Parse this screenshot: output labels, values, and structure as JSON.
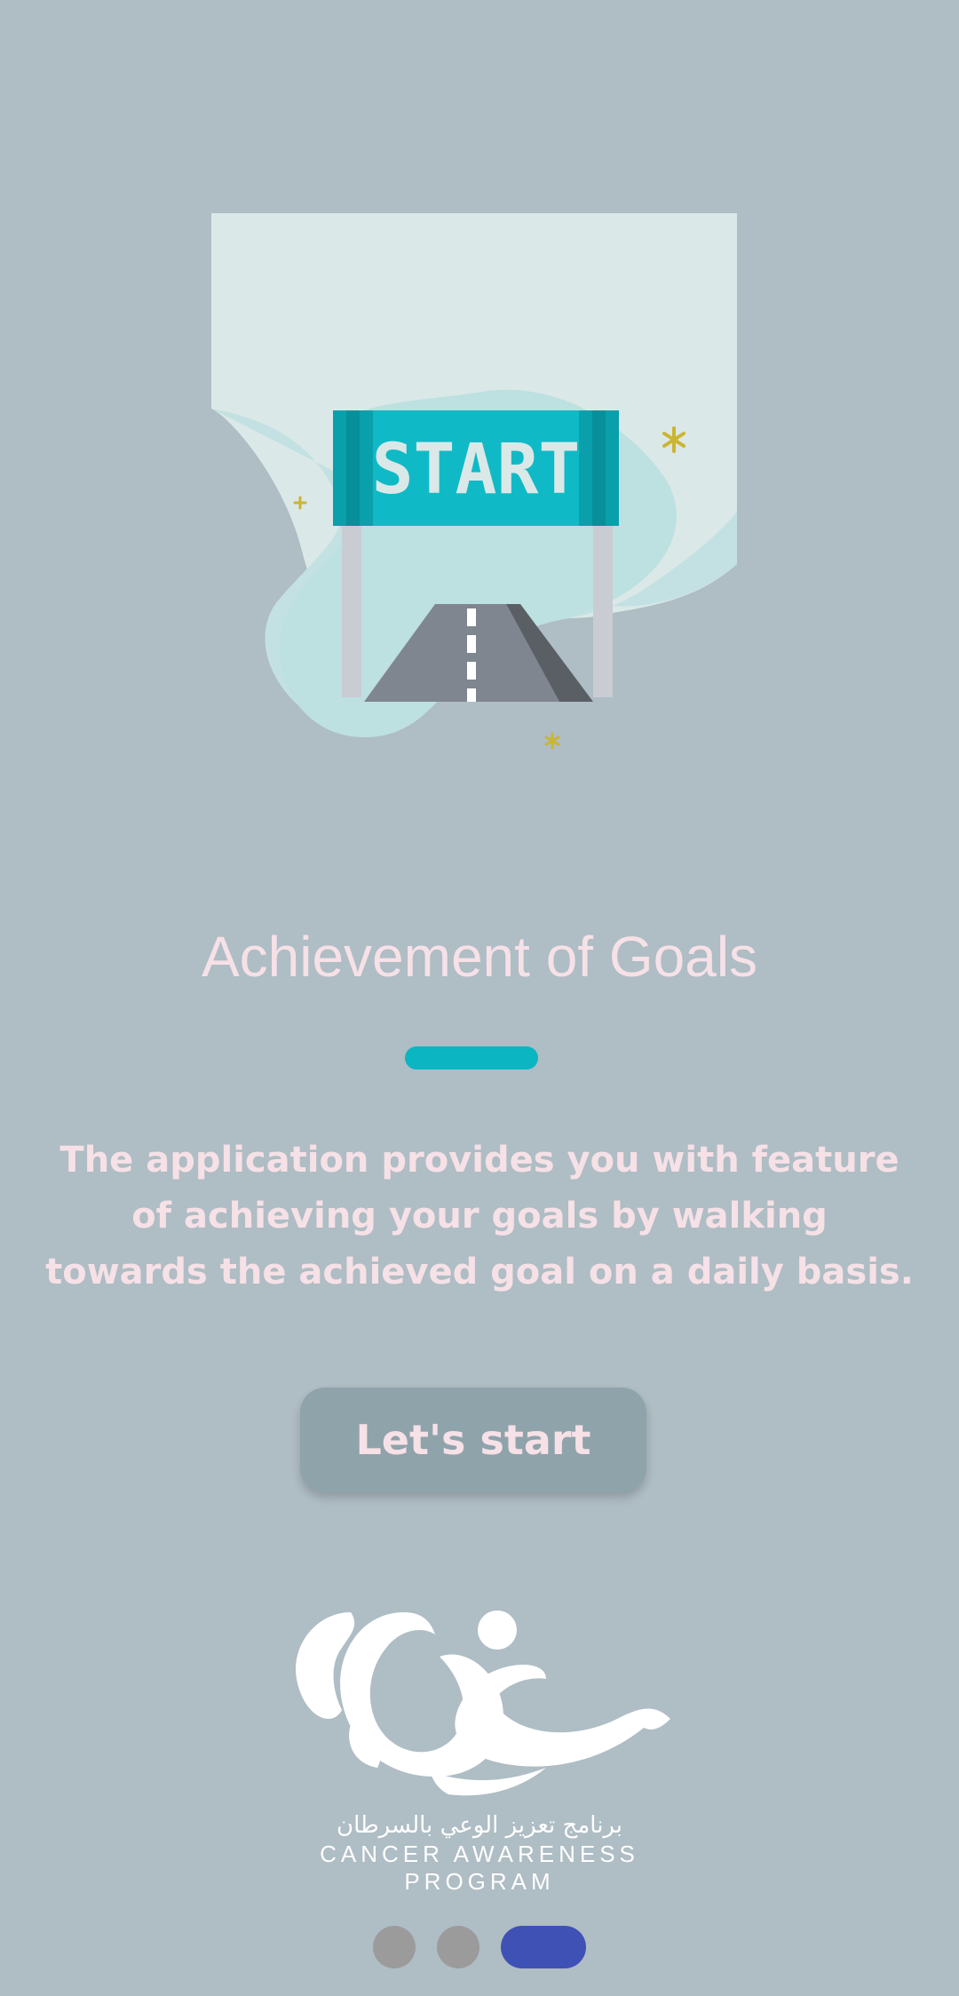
{
  "illustration": {
    "sign_text": "START"
  },
  "title": "Achievement of Goals",
  "description": "The application provides you with feature of achieving your goals by walking towards the achieved goal on a daily basis.",
  "start_button": {
    "label": "Let's start"
  },
  "logo": {
    "arabic_text": "برنامج تعزيز الوعي بالسرطان",
    "english_text": "CANCER AWARENESS PROGRAM"
  },
  "pagination": {
    "total": 3,
    "current": 3
  },
  "colors": {
    "background": "#afbdc4",
    "accent": "#0bb5c2",
    "title_text": "#f6e1e7",
    "button": "#8fa3ab",
    "active_dot": "#3f51b5",
    "inactive_dot": "#9b9b9b"
  }
}
